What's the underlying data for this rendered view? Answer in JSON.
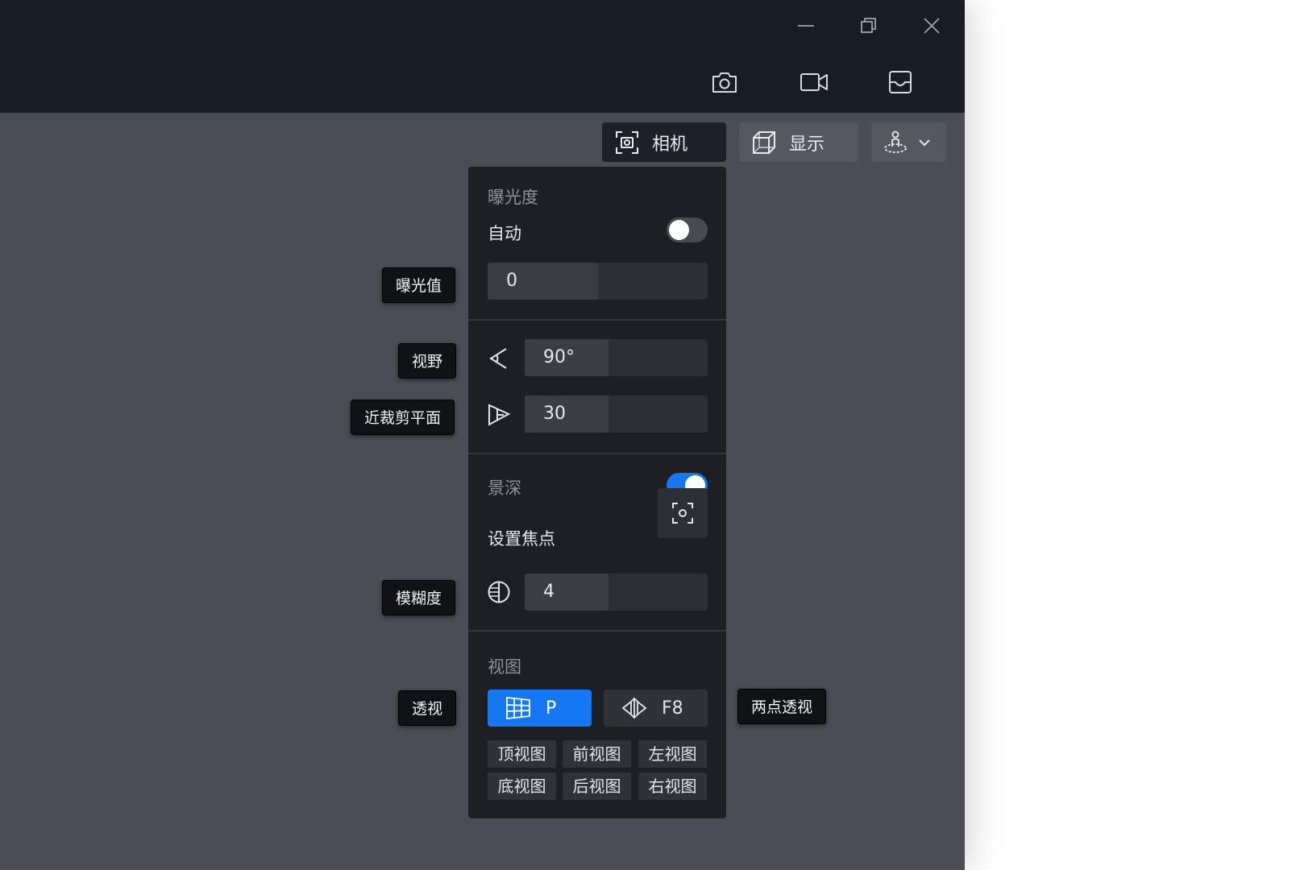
{
  "tabs": {
    "camera_label": "相机",
    "display_label": "显示"
  },
  "exposure": {
    "title": "曝光度",
    "auto_label": "自动",
    "auto_on": false,
    "value": "0",
    "value_fraction": 0.5
  },
  "fov": {
    "value": "90°",
    "value_fraction": 0.46
  },
  "near_clip": {
    "value": "30",
    "value_fraction": 0.46
  },
  "dof": {
    "title": "景深",
    "enabled": true,
    "set_focus_label": "设置焦点",
    "blur_value": "4",
    "blur_fraction": 0.46
  },
  "view": {
    "title": "视图",
    "perspective_label": "P",
    "two_point_label": "F8",
    "buttons": [
      "顶视图",
      "前视图",
      "左视图",
      "底视图",
      "后视图",
      "右视图"
    ]
  },
  "tooltips": {
    "exposure_value": "曝光值",
    "fov": "视野",
    "near_clip": "近裁剪平面",
    "blur": "模糊度",
    "perspective": "透视",
    "two_point": "两点透视"
  },
  "colors": {
    "accent": "#1677f2",
    "titlebar": "#181c27",
    "viewport": "#4a4d55",
    "panel": "#1d1f25"
  },
  "icons": {
    "minimize": "minimize-icon",
    "restore": "restore-icon",
    "close": "close-icon",
    "screenshot": "camera-icon",
    "record": "video-camera-icon",
    "tray": "inbox-tray-icon",
    "camera_tab": "focus-frame-icon",
    "display_tab": "wireframe-cube-icon",
    "navigation": "walk-mode-icon",
    "dropdown": "chevron-down-icon",
    "fov": "angle-icon",
    "near_clip": "clip-plane-icon",
    "focus": "focus-target-icon",
    "blur": "aperture-icon",
    "perspective": "perspective-grid-icon",
    "two_point": "two-point-perspective-icon"
  }
}
